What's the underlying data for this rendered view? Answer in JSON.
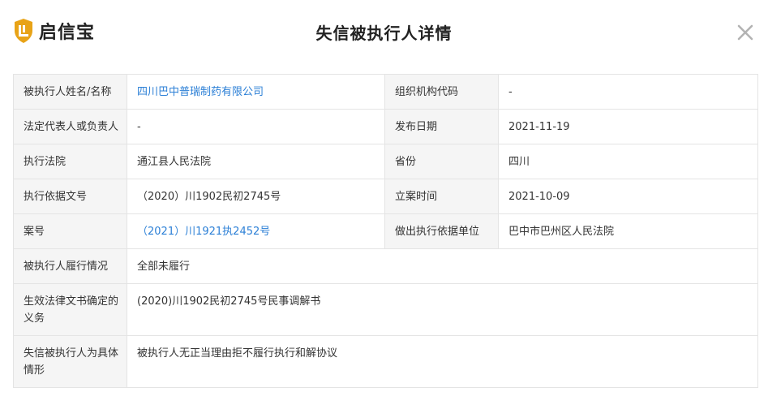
{
  "brand": {
    "name": "启信宝",
    "accent_color": "#e8a317",
    "icon": "shield-logo-icon"
  },
  "dialog": {
    "title": "失信被执行人详情",
    "close_icon": "close-icon"
  },
  "fields": {
    "name_label": "被执行人姓名/名称",
    "name_value": "四川巴中普瑞制药有限公司",
    "org_code_label": "组织机构代码",
    "org_code_value": "-",
    "legal_rep_label": "法定代表人或负责人",
    "legal_rep_value": "-",
    "publish_date_label": "发布日期",
    "publish_date_value": "2021-11-19",
    "court_label": "执行法院",
    "court_value": "通江县人民法院",
    "province_label": "省份",
    "province_value": "四川",
    "basis_doc_label": "执行依据文号",
    "basis_doc_value": "（2020）川1902民初2745号",
    "filing_date_label": "立案时间",
    "filing_date_value": "2021-10-09",
    "case_no_label": "案号",
    "case_no_value": "（2021）川1921执2452号",
    "basis_unit_label": "做出执行依据单位",
    "basis_unit_value": "巴中市巴州区人民法院",
    "performance_label": "被执行人履行情况",
    "performance_value": "全部未履行",
    "obligation_label": "生效法律文书确定的义务",
    "obligation_value": "(2020)川1902民初2745号民事调解书",
    "circumstance_label": "失信被执行人为具体情形",
    "circumstance_value": "被执行人无正当理由拒不履行执行和解协议"
  },
  "colors": {
    "link": "#2b7fd6",
    "label_bg": "#f5f5f5",
    "border": "#e4e4e4"
  }
}
